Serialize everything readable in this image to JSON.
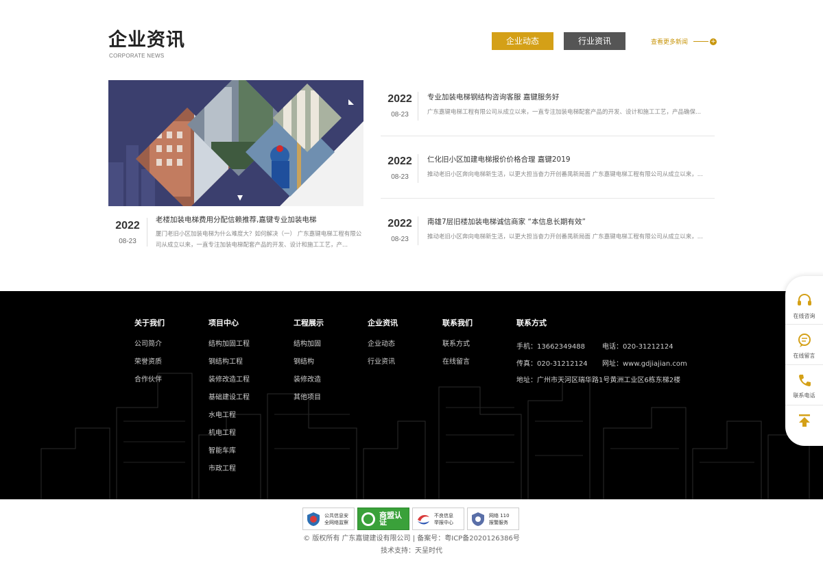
{
  "section": {
    "title": "企业资讯",
    "subtitle": "CORPORATE NEWS",
    "tab_active": "企业动态",
    "tab_inactive": "行业资讯",
    "more_link": "查看更多新闻"
  },
  "featured": {
    "year": "2022",
    "md": "08-23",
    "title": "老楼加装电梯费用分配信赖推荐,嘉键专业加装电梯",
    "desc": "厦门老旧小区加装电梯为什么难度大？如何解决（一） 广东嘉键电梯工程有限公司从成立以来，一直专注加装电梯配套产品的开发、设计和施工工艺，产..."
  },
  "news": [
    {
      "year": "2022",
      "md": "08-23",
      "title": "专业加装电梯钢结构咨询客服 嘉键服务好",
      "desc": "广东嘉键电梯工程有限公司从成立以来，一直专注加装电梯配套产品的开发、设计和施工工艺，产品确保..."
    },
    {
      "year": "2022",
      "md": "08-23",
      "title": "仁化旧小区加建电梯报价价格合理 嘉键2019",
      "desc": "推动老旧小区奔向电梯新生活，以更大担当奋力开创番禺新局面 广东嘉键电梯工程有限公司从成立以来，..."
    },
    {
      "year": "2022",
      "md": "08-23",
      "title": "南雄7层旧楼加装电梯诚信商家 “本信息长期有效”",
      "desc": "推动老旧小区奔向电梯新生活，以更大担当奋力开创番禺新局面 广东嘉键电梯工程有限公司从成立以来，..."
    }
  ],
  "footer": {
    "columns": [
      {
        "head": "关于我们",
        "items": [
          "公司简介",
          "荣誉资质",
          "合作伙伴"
        ]
      },
      {
        "head": "项目中心",
        "items": [
          "结构加固工程",
          "钢结构工程",
          "装修改造工程",
          "基础建设工程",
          "水电工程",
          "机电工程",
          "智能车库",
          "市政工程"
        ]
      },
      {
        "head": "工程展示",
        "items": [
          "结构加固",
          "钢结构",
          "装修改造",
          "其他项目"
        ]
      },
      {
        "head": "企业资讯",
        "items": [
          "企业动态",
          "行业资讯"
        ]
      },
      {
        "head": "联系我们",
        "items": [
          "联系方式",
          "在线留言"
        ]
      }
    ],
    "contact": {
      "head": "联系方式",
      "mobile": "手机：13662349488",
      "phone": "电话：020-31212124",
      "fax": "传真：020-31212124",
      "website": "网址：www.gdjiajian.com",
      "address": "地址：广州市天河区瑞华路1号黄洲工业区6栋东梯2楼"
    }
  },
  "badges": [
    {
      "icon": "public-security-icon",
      "line1": "公共信息安",
      "line2": "全网络监察"
    },
    {
      "icon": "merchant-cert-icon",
      "line1": "商盟认证",
      "line2": ""
    },
    {
      "icon": "report-center-icon",
      "line1": "不良信息",
      "line2": "举报中心"
    },
    {
      "icon": "police-110-icon",
      "line1": "网络 110",
      "line2": "报警服务"
    }
  ],
  "copyright": "© 版权所有 广东嘉键建设有限公司 | 备案号：粤ICP备2020126386号",
  "tech_support": "技术支持：天呈时代",
  "sidebar": {
    "consult": "在线咨询",
    "message": "在线留言",
    "phone": "联系电话"
  },
  "colors": {
    "accent": "#d4a017",
    "tab_inactive": "#555555",
    "footer_bg": "#000000"
  }
}
